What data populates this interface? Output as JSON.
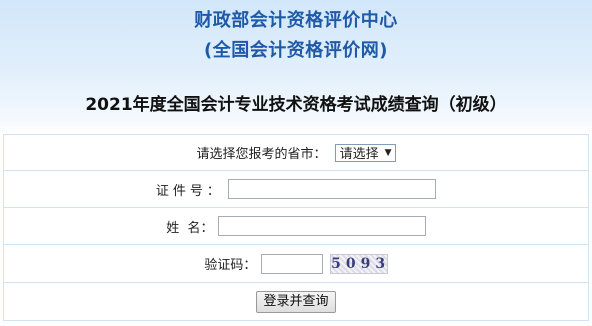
{
  "header": {
    "org_title_line1": "财政部会计资格评价中心",
    "org_title_line2": "(全国会计资格评价网)",
    "page_title": "2021年度全国会计专业技术资格考试成绩查询（初级）"
  },
  "form": {
    "province_label": "请选择您报考的省市：",
    "province_select": {
      "selected": "请选择"
    },
    "id_label": "证件号：",
    "id_value": "",
    "name_label": "姓  名：",
    "name_value": "",
    "captcha_label": "验证码：",
    "captcha_value": "",
    "captcha_image_text": "5093",
    "submit_label": "登录并查询"
  },
  "colors": {
    "title_blue": "#1f5aa8",
    "table_border": "#cfe3f2",
    "header_bg_top": "#d2e7fa"
  },
  "icons": {
    "select_caret": "chevron-down-icon"
  }
}
